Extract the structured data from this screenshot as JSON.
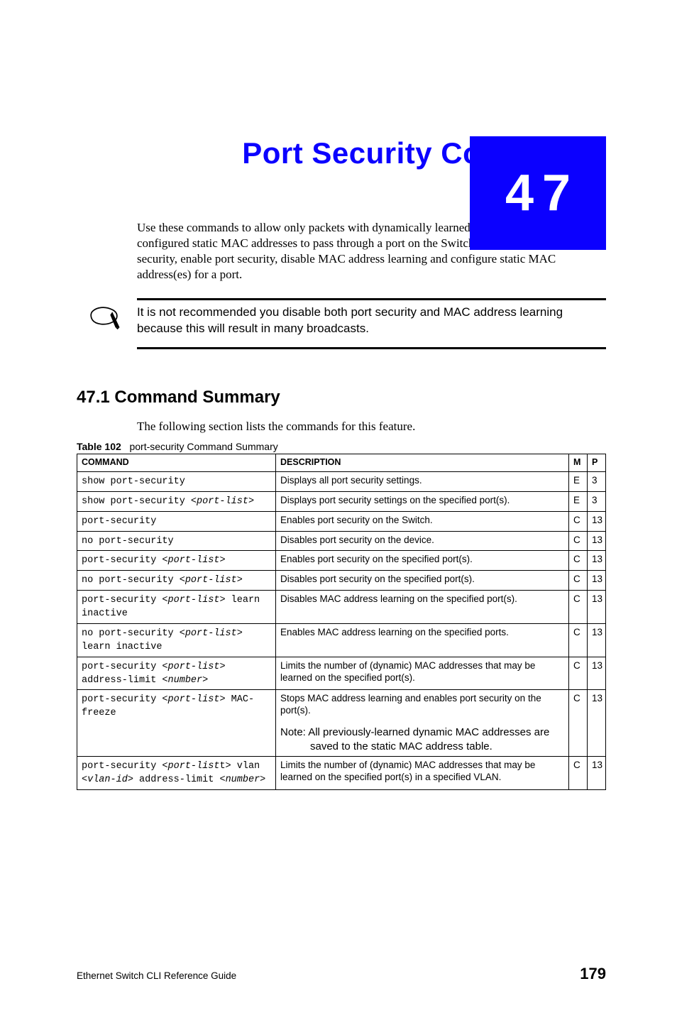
{
  "chapter": {
    "number": "47",
    "title": "Port Security Commands"
  },
  "intro": "Use these commands to allow only packets with dynamically learned MAC addresses and/or configured static MAC addresses to pass through a port on the Switch. For maximum port security, enable port security, disable MAC address learning and configure static MAC address(es) for a port.",
  "note": "It is not recommended you disable both port security and MAC address learning because this will result in many broadcasts.",
  "section": {
    "heading": "47.1  Command Summary",
    "intro": "The following section lists the commands for this feature."
  },
  "table": {
    "label": "Table 102",
    "caption": "port-security Command Summary",
    "headers": {
      "command": "COMMAND",
      "description": "DESCRIPTION",
      "m": "M",
      "p": "P"
    },
    "rows": [
      {
        "segments": [
          {
            "t": "show port-security"
          }
        ],
        "description": "Displays all port security settings.",
        "m": "E",
        "p": "3"
      },
      {
        "segments": [
          {
            "t": "show port-security <"
          },
          {
            "t": "port-list",
            "i": true
          },
          {
            "t": ">"
          }
        ],
        "description": "Displays port security settings on the specified port(s).",
        "m": "E",
        "p": "3"
      },
      {
        "segments": [
          {
            "t": "port-security"
          }
        ],
        "description": "Enables port security on the Switch.",
        "m": "C",
        "p": "13"
      },
      {
        "segments": [
          {
            "t": "no port-security"
          }
        ],
        "description": "Disables port security on the device.",
        "m": "C",
        "p": "13"
      },
      {
        "segments": [
          {
            "t": "port-security <"
          },
          {
            "t": "port-list",
            "i": true
          },
          {
            "t": ">"
          }
        ],
        "description": "Enables port security on the specified port(s).",
        "m": "C",
        "p": "13"
      },
      {
        "segments": [
          {
            "t": "no port-security <"
          },
          {
            "t": "port-list",
            "i": true
          },
          {
            "t": ">"
          }
        ],
        "description": "Disables port security on the specified port(s).",
        "m": "C",
        "p": "13"
      },
      {
        "segments": [
          {
            "t": "port-security <"
          },
          {
            "t": "port-list",
            "i": true
          },
          {
            "t": "> learn inactive"
          }
        ],
        "description": "Disables MAC address learning on the specified port(s).",
        "m": "C",
        "p": "13"
      },
      {
        "segments": [
          {
            "t": "no port-security <"
          },
          {
            "t": "port-list",
            "i": true
          },
          {
            "t": "> learn inactive"
          }
        ],
        "description": "Enables MAC address learning on the specified ports.",
        "m": "C",
        "p": "13"
      },
      {
        "segments": [
          {
            "t": "port-security <"
          },
          {
            "t": "port-list",
            "i": true
          },
          {
            "t": "> address-limit <"
          },
          {
            "t": "number",
            "i": true
          },
          {
            "t": ">"
          }
        ],
        "description": "Limits the number of (dynamic) MAC addresses that may be learned on the specified port(s).",
        "m": "C",
        "p": "13"
      },
      {
        "segments": [
          {
            "t": "port-security <"
          },
          {
            "t": "port-list",
            "i": true
          },
          {
            "t": "> MAC-freeze"
          }
        ],
        "description": "Stops MAC address learning and enables port security on the port(s).",
        "note": "Note: All previously-learned dynamic MAC addresses are saved to the static MAC address table.",
        "m": "C",
        "p": "13"
      },
      {
        "segments": [
          {
            "t": "port-security <"
          },
          {
            "t": "port-list",
            "i": true
          },
          {
            "t": "t> vlan <"
          },
          {
            "t": "vlan-id",
            "i": true
          },
          {
            "t": "> address-limit <"
          },
          {
            "t": "number",
            "i": true
          },
          {
            "t": ">"
          }
        ],
        "description": "Limits the number of (dynamic) MAC addresses that may be learned on the specified port(s) in a specified VLAN.",
        "m": "C",
        "p": "13"
      }
    ]
  },
  "footer": {
    "left": "Ethernet Switch CLI Reference Guide",
    "right": "179"
  }
}
